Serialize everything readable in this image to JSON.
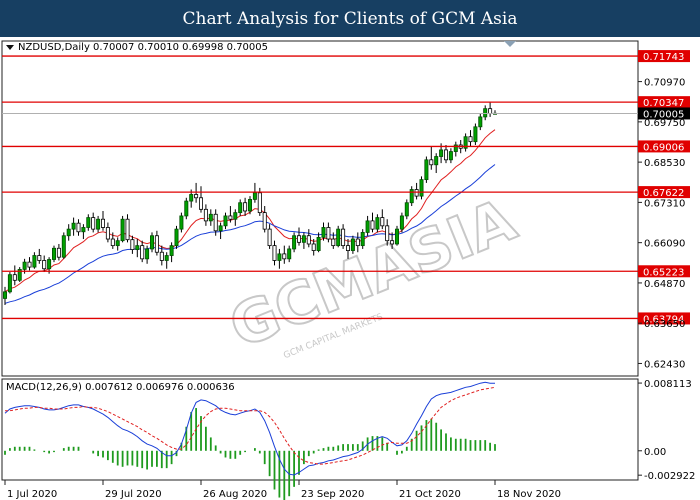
{
  "banner": {
    "title": "Chart Analysis for Clients of GCM Asia"
  },
  "watermark": {
    "text": "GCMASIA",
    "subtext": "GCM CAPITAL MARKETS"
  },
  "chart_data": [
    {
      "type": "candlestick",
      "title": "NZDUSD,Daily  0.70007 0.70010 0.69998 0.70005",
      "ylim": [
        0.6205,
        0.722
      ],
      "y_ticks": [
        0.7097,
        0.6975,
        0.6853,
        0.6731,
        0.6609,
        0.6487,
        0.6365,
        0.6243
      ],
      "x_ticks": [
        "1 Jul 2020",
        "29 Jul 2020",
        "26 Aug 2020",
        "23 Sep 2020",
        "21 Oct 2020",
        "18 Nov 2020"
      ],
      "x_tick_index": [
        0,
        20,
        40,
        60,
        80,
        100
      ],
      "current_price": 0.70005,
      "levels": [
        0.71743,
        0.70347,
        0.69006,
        0.67622,
        0.65223,
        0.63794
      ],
      "overlays": [
        {
          "kind": "moving average",
          "color": "#e02020"
        },
        {
          "kind": "moving average",
          "color": "#1a3fd8"
        }
      ],
      "colors": {
        "bull": "#00a000",
        "bear": "#000000",
        "level": "#e00000"
      },
      "ohlc": [
        [
          0.644,
          0.6475,
          0.642,
          0.646
        ],
        [
          0.646,
          0.652,
          0.6455,
          0.6512
        ],
        [
          0.6512,
          0.654,
          0.648,
          0.6495
        ],
        [
          0.6495,
          0.6535,
          0.649,
          0.6528
        ],
        [
          0.6528,
          0.656,
          0.6515,
          0.655
        ],
        [
          0.655,
          0.6565,
          0.6525,
          0.6535
        ],
        [
          0.6535,
          0.658,
          0.653,
          0.657
        ],
        [
          0.657,
          0.659,
          0.6545,
          0.6555
        ],
        [
          0.6555,
          0.657,
          0.652,
          0.653
        ],
        [
          0.653,
          0.6565,
          0.6515,
          0.6558
        ],
        [
          0.6558,
          0.66,
          0.655,
          0.6592
        ],
        [
          0.6592,
          0.6605,
          0.6555,
          0.6565
        ],
        [
          0.6565,
          0.664,
          0.656,
          0.663
        ],
        [
          0.663,
          0.6665,
          0.6615,
          0.665
        ],
        [
          0.665,
          0.6685,
          0.663,
          0.6668
        ],
        [
          0.6668,
          0.668,
          0.663,
          0.6642
        ],
        [
          0.6642,
          0.6665,
          0.662,
          0.6655
        ],
        [
          0.6655,
          0.6695,
          0.6645,
          0.6685
        ],
        [
          0.6685,
          0.67,
          0.664,
          0.665
        ],
        [
          0.665,
          0.669,
          0.664,
          0.668
        ],
        [
          0.668,
          0.6705,
          0.6645,
          0.6655
        ],
        [
          0.6655,
          0.667,
          0.661,
          0.662
        ],
        [
          0.662,
          0.664,
          0.659,
          0.66
        ],
        [
          0.66,
          0.6625,
          0.6585,
          0.6615
        ],
        [
          0.6615,
          0.669,
          0.661,
          0.668
        ],
        [
          0.668,
          0.6695,
          0.661,
          0.6618
        ],
        [
          0.6618,
          0.663,
          0.6575,
          0.6588
        ],
        [
          0.6588,
          0.662,
          0.6565,
          0.66
        ],
        [
          0.66,
          0.6615,
          0.655,
          0.656
        ],
        [
          0.656,
          0.66,
          0.6545,
          0.659
        ],
        [
          0.659,
          0.664,
          0.658,
          0.663
        ],
        [
          0.663,
          0.6645,
          0.657,
          0.658
        ],
        [
          0.658,
          0.66,
          0.654,
          0.6555
        ],
        [
          0.6555,
          0.658,
          0.653,
          0.657
        ],
        [
          0.657,
          0.661,
          0.655,
          0.66
        ],
        [
          0.66,
          0.666,
          0.659,
          0.665
        ],
        [
          0.665,
          0.67,
          0.664,
          0.669
        ],
        [
          0.669,
          0.6745,
          0.668,
          0.6735
        ],
        [
          0.6735,
          0.677,
          0.6715,
          0.6755
        ],
        [
          0.6755,
          0.679,
          0.673,
          0.6745
        ],
        [
          0.6745,
          0.678,
          0.67,
          0.671
        ],
        [
          0.671,
          0.6725,
          0.666,
          0.6675
        ],
        [
          0.6675,
          0.671,
          0.666,
          0.6695
        ],
        [
          0.6695,
          0.671,
          0.663,
          0.6645
        ],
        [
          0.6645,
          0.667,
          0.662,
          0.666
        ],
        [
          0.666,
          0.67,
          0.665,
          0.669
        ],
        [
          0.669,
          0.672,
          0.667,
          0.668
        ],
        [
          0.668,
          0.671,
          0.666,
          0.67
        ],
        [
          0.67,
          0.674,
          0.669,
          0.673
        ],
        [
          0.673,
          0.6745,
          0.669,
          0.6705
        ],
        [
          0.6705,
          0.675,
          0.6695,
          0.674
        ],
        [
          0.674,
          0.679,
          0.673,
          0.676
        ],
        [
          0.676,
          0.6775,
          0.669,
          0.67
        ],
        [
          0.67,
          0.672,
          0.664,
          0.665
        ],
        [
          0.665,
          0.6665,
          0.659,
          0.66
        ],
        [
          0.66,
          0.6615,
          0.654,
          0.6555
        ],
        [
          0.6555,
          0.659,
          0.653,
          0.6575
        ],
        [
          0.6575,
          0.66,
          0.6545,
          0.656
        ],
        [
          0.656,
          0.66,
          0.655,
          0.659
        ],
        [
          0.659,
          0.664,
          0.658,
          0.663
        ],
        [
          0.663,
          0.6655,
          0.66,
          0.661
        ],
        [
          0.661,
          0.664,
          0.659,
          0.663
        ],
        [
          0.663,
          0.665,
          0.6595,
          0.6605
        ],
        [
          0.6605,
          0.662,
          0.657,
          0.6585
        ],
        [
          0.6585,
          0.664,
          0.658,
          0.6625
        ],
        [
          0.6625,
          0.667,
          0.6615,
          0.6655
        ],
        [
          0.6655,
          0.667,
          0.661,
          0.662
        ],
        [
          0.662,
          0.664,
          0.659,
          0.66
        ],
        [
          0.66,
          0.666,
          0.6595,
          0.665
        ],
        [
          0.665,
          0.6665,
          0.659,
          0.66
        ],
        [
          0.66,
          0.662,
          0.656,
          0.6585
        ],
        [
          0.6585,
          0.663,
          0.6575,
          0.662
        ],
        [
          0.662,
          0.664,
          0.658,
          0.66
        ],
        [
          0.66,
          0.665,
          0.659,
          0.664
        ],
        [
          0.664,
          0.669,
          0.663,
          0.6675
        ],
        [
          0.6675,
          0.67,
          0.664,
          0.665
        ],
        [
          0.665,
          0.6695,
          0.664,
          0.6685
        ],
        [
          0.6685,
          0.671,
          0.665,
          0.666
        ],
        [
          0.666,
          0.668,
          0.66,
          0.6615
        ],
        [
          0.6615,
          0.664,
          0.659,
          0.6605
        ],
        [
          0.6605,
          0.666,
          0.66,
          0.665
        ],
        [
          0.665,
          0.67,
          0.664,
          0.669
        ],
        [
          0.669,
          0.674,
          0.668,
          0.673
        ],
        [
          0.673,
          0.678,
          0.672,
          0.677
        ],
        [
          0.677,
          0.679,
          0.674,
          0.675
        ],
        [
          0.675,
          0.681,
          0.674,
          0.68
        ],
        [
          0.68,
          0.687,
          0.679,
          0.686
        ],
        [
          0.686,
          0.69,
          0.683,
          0.6845
        ],
        [
          0.6845,
          0.688,
          0.682,
          0.687
        ],
        [
          0.687,
          0.691,
          0.685,
          0.689
        ],
        [
          0.689,
          0.6905,
          0.685,
          0.686
        ],
        [
          0.686,
          0.6895,
          0.685,
          0.6885
        ],
        [
          0.6885,
          0.6915,
          0.687,
          0.6905
        ],
        [
          0.6905,
          0.692,
          0.688,
          0.6895
        ],
        [
          0.6895,
          0.694,
          0.6885,
          0.693
        ],
        [
          0.693,
          0.695,
          0.69,
          0.6915
        ],
        [
          0.6915,
          0.697,
          0.6905,
          0.696
        ],
        [
          0.696,
          0.7,
          0.695,
          0.699
        ],
        [
          0.699,
          0.7025,
          0.698,
          0.7015
        ],
        [
          0.7015,
          0.7035,
          0.699,
          0.7
        ],
        [
          0.7,
          0.701,
          0.6998,
          0.7001
        ]
      ]
    },
    {
      "type": "macd",
      "title": "MACD(12,26,9) 0.007612 0.006976 0.000636",
      "ylim": [
        -0.0035,
        0.0086
      ],
      "y_ticks": [
        0.008113,
        0.0,
        -0.002922
      ],
      "zero_level": 0.0,
      "macd": [
        0.0045,
        0.005,
        0.0052,
        0.0053,
        0.0054,
        0.0054,
        0.0053,
        0.0052,
        0.005,
        0.0049,
        0.0049,
        0.005,
        0.0052,
        0.0054,
        0.0055,
        0.0055,
        0.0053,
        0.0052,
        0.005,
        0.0047,
        0.0044,
        0.004,
        0.0035,
        0.003,
        0.0026,
        0.0024,
        0.0021,
        0.0017,
        0.0012,
        0.0008,
        0.0006,
        0.0003,
        -0.0002,
        -0.0006,
        -0.0006,
        -0.0002,
        0.0008,
        0.0025,
        0.0045,
        0.0058,
        0.0061,
        0.006,
        0.0057,
        0.0054,
        0.0049,
        0.0046,
        0.0044,
        0.0043,
        0.0045,
        0.0047,
        0.0048,
        0.005,
        0.0046,
        0.0036,
        0.0022,
        0.0005,
        -0.001,
        -0.0022,
        -0.0028,
        -0.0029,
        -0.0026,
        -0.0022,
        -0.0018,
        -0.0017,
        -0.0015,
        -0.0014,
        -0.0012,
        -0.0011,
        -0.0009,
        -0.0007,
        -0.0006,
        -0.0004,
        -0.0002,
        0.0002,
        0.0008,
        0.0012,
        0.0015,
        0.0017,
        0.0015,
        0.001,
        0.0006,
        0.0007,
        0.0012,
        0.0021,
        0.0032,
        0.0042,
        0.0053,
        0.0062,
        0.0066,
        0.0068,
        0.0069,
        0.007,
        0.0072,
        0.0074,
        0.0076,
        0.0077,
        0.0079,
        0.0081,
        0.0082,
        0.0081,
        0.0081
      ],
      "signal": [
        0.0048,
        0.0048,
        0.0049,
        0.005,
        0.0051,
        0.0051,
        0.0052,
        0.0052,
        0.0051,
        0.0051,
        0.005,
        0.005,
        0.005,
        0.0051,
        0.0052,
        0.0052,
        0.0053,
        0.0052,
        0.0052,
        0.0051,
        0.0049,
        0.0047,
        0.0044,
        0.0041,
        0.0038,
        0.0035,
        0.0032,
        0.0029,
        0.0025,
        0.0022,
        0.0018,
        0.0015,
        0.0011,
        0.0007,
        0.0004,
        0.0002,
        0.0002,
        0.0007,
        0.0016,
        0.0026,
        0.0035,
        0.0042,
        0.0047,
        0.005,
        0.0051,
        0.0051,
        0.005,
        0.0049,
        0.0048,
        0.0048,
        0.0048,
        0.0048,
        0.0048,
        0.0046,
        0.0041,
        0.0034,
        0.0025,
        0.0015,
        0.0006,
        -0.0002,
        -0.0008,
        -0.0012,
        -0.0014,
        -0.0015,
        -0.0016,
        -0.0016,
        -0.0015,
        -0.0014,
        -0.0013,
        -0.0012,
        -0.0011,
        -0.0009,
        -0.0007,
        -0.0005,
        -0.0002,
        0.0001,
        0.0004,
        0.0007,
        0.0009,
        0.001,
        0.0009,
        0.0009,
        0.0009,
        0.0012,
        0.0017,
        0.0023,
        0.003,
        0.0038,
        0.0045,
        0.0052,
        0.0056,
        0.006,
        0.0063,
        0.0065,
        0.0067,
        0.0069,
        0.0071,
        0.0073,
        0.0074,
        0.0075,
        0.0076
      ],
      "colors": {
        "macd": "#1a3fd8",
        "signal": "#e02020",
        "histogram": "#1e9a1e"
      }
    }
  ]
}
